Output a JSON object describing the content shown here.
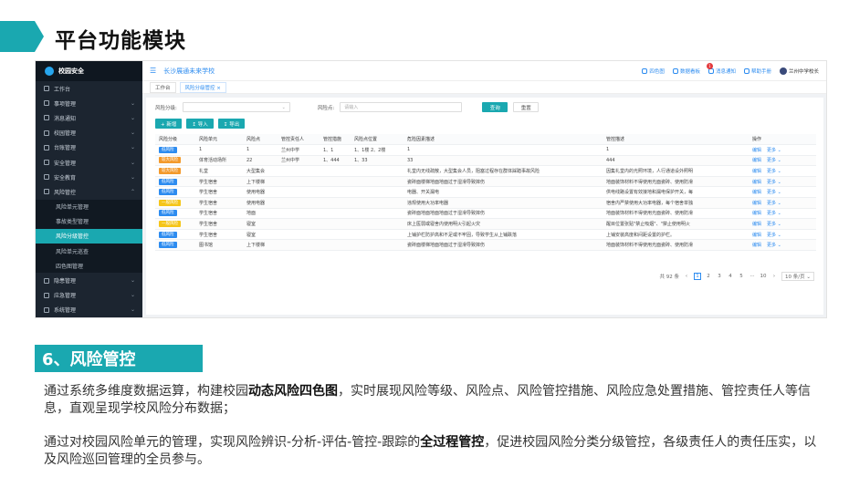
{
  "slide": {
    "title": "平台功能模块",
    "section_title": "6、风险管控",
    "para1": {
      "a": "通过系统多维度数据运算，构建校园",
      "b": "动态风险四色图",
      "c": "，实时展现风险等级、风险点、风险管控措施、风险应急处置措施、管控责任人等信息，直观呈现学校风险分布数据；"
    },
    "para2": {
      "a": "通过对校园风险单元的管理，实现风险辨识-分析-评估-管控-跟踪的",
      "b": "全过程管控",
      "c": "，促进校园风险分类分级管控，各级责任人的责任压实，以及风险巡回管理的全员参与。"
    }
  },
  "app": {
    "logo": "校园安全",
    "school": "长沙展通未来学校",
    "tools": {
      "t1": "四色图",
      "t2": "数据看板",
      "t3": "消息通知",
      "t3_badge": "1",
      "t4": "帮助手册",
      "user": "兰州中学校长"
    },
    "menu": [
      {
        "label": "工作台",
        "chev": ""
      },
      {
        "label": "事项管理",
        "chev": "⌄"
      },
      {
        "label": "消息通知",
        "chev": "⌄"
      },
      {
        "label": "校园管理",
        "chev": "⌄"
      },
      {
        "label": "台账管理",
        "chev": "⌄"
      },
      {
        "label": "安全管理",
        "chev": "⌄"
      },
      {
        "label": "安全教育",
        "chev": "⌄"
      },
      {
        "label": "风险管控",
        "chev": "⌃"
      }
    ],
    "submenu": [
      "风险单元管理",
      "事故类型管理",
      "风险分级管控",
      "风险单元巡查",
      "四色图管理"
    ],
    "menu_after": [
      {
        "label": "隐患管理",
        "chev": "⌄"
      },
      {
        "label": "应急管理",
        "chev": "⌄"
      },
      {
        "label": "系统管理",
        "chev": "⌄"
      }
    ],
    "tabs": [
      "工作台",
      "风险分级管控 ×"
    ],
    "filter": {
      "level_label": "风险分级:",
      "point_label": "风险点:",
      "point_placeholder": "请输入",
      "search": "查询",
      "reset": "重置"
    },
    "actions": {
      "add": "+ 新增",
      "import": "↥ 导入",
      "export": "↧ 导出"
    },
    "columns": [
      "风险分级",
      "风险单元",
      "风险点",
      "管控责任人",
      "管控措施",
      "风险点位置",
      "危险因素描述",
      "",
      "管控描述",
      "",
      "操作"
    ],
    "rows": [
      {
        "lvl": "低风险",
        "c": "#2d8cf0",
        "unit": "1",
        "point": "1",
        "resp": "兰州中学",
        "m": "1、1",
        "pos": "1、1楼 2、2楼",
        "risk": "1",
        "ctrl": "1",
        "edit": "编辑",
        "more": "更多 ⌄"
      },
      {
        "lvl": "较大风险",
        "c": "#f39a2c",
        "unit": "体育活动场所",
        "point": "22",
        "resp": "兰州中学",
        "m": "1、444",
        "pos": "1、33",
        "risk": "33",
        "ctrl": "444",
        "edit": "编辑",
        "more": "更多 ⌄"
      },
      {
        "lvl": "较大风险",
        "c": "#f39a2c",
        "unit": "礼堂",
        "point": "大型集会",
        "resp": "",
        "m": "",
        "pos": "",
        "risk": "礼堂内无线疏散，大型集会人员，阻塞过程存在群体踩踏事故风险",
        "ctrl": "因集礼堂内的光照环境，人行通道设外照明",
        "edit": "编辑",
        "more": "更多 ⌄"
      },
      {
        "lvl": "低风险",
        "c": "#2d8cf0",
        "unit": "学生宿舍",
        "point": "上下楼梯",
        "resp": "",
        "m": "",
        "pos": "",
        "risk": "瓷砖面楼梯地面地面过于湿滑导致摔伤",
        "ctrl": "地面装饰材料不得使用光面瓷砖、使用防滑",
        "edit": "编辑",
        "more": "更多 ⌄"
      },
      {
        "lvl": "低风险",
        "c": "#2d8cf0",
        "unit": "学生宿舍",
        "point": "使用电器",
        "resp": "",
        "m": "",
        "pos": "",
        "risk": "电器、开关漏电",
        "ctrl": "供电线路设置有效接地和漏电保护开关，每",
        "edit": "编辑",
        "more": "更多 ⌄"
      },
      {
        "lvl": "一般风险",
        "c": "#f5c518",
        "unit": "学生宿舍",
        "point": "使用电器",
        "resp": "",
        "m": "",
        "pos": "",
        "risk": "违规使用大功率电器",
        "ctrl": "宿舍内严禁使用大功率电器，每个宿舍单独",
        "edit": "编辑",
        "more": "更多 ⌄"
      },
      {
        "lvl": "低风险",
        "c": "#2d8cf0",
        "unit": "学生宿舍",
        "point": "地面",
        "resp": "",
        "m": "",
        "pos": "",
        "risk": "瓷砖面地面地面地面过于湿滑导致摔伤",
        "ctrl": "地面装饰材料不得使用光面瓷砖、使用防滑",
        "edit": "编辑",
        "more": "更多 ⌄"
      },
      {
        "lvl": "一般风险",
        "c": "#f5c518",
        "unit": "学生宿舍",
        "point": "寝室",
        "resp": "",
        "m": "",
        "pos": "",
        "risk": "床上医弱或寝舍内使用明火引起火灾",
        "ctrl": "醒目位置张贴\"禁止吸烟\"、\"禁止使用明火",
        "edit": "编辑",
        "more": "更多 ⌄"
      },
      {
        "lvl": "低风险",
        "c": "#2d8cf0",
        "unit": "学生宿舍",
        "point": "寝室",
        "resp": "",
        "m": "",
        "pos": "",
        "risk": "上铺护栏防护高和不足或不牢固，导致学生从上铺跌落",
        "ctrl": "上铺安装高度和间距设置的护栏。",
        "edit": "编辑",
        "more": "更多 ⌄"
      },
      {
        "lvl": "低风险",
        "c": "#2d8cf0",
        "unit": "图书馆",
        "point": "上下楼梯",
        "resp": "",
        "m": "",
        "pos": "",
        "risk": "瓷砖面楼梯地面地面过于湿滑导致摔伤",
        "ctrl": "地面装饰材料不得使用光面瓷砖、使用防滑",
        "edit": "编辑",
        "more": "更多 ⌄"
      }
    ],
    "pager": {
      "total": "共 92 条",
      "prev": "‹",
      "p1": "1",
      "p2": "2",
      "p3": "3",
      "p4": "4",
      "p5": "5",
      "dots": "···",
      "last": "10",
      "next": "›",
      "size": "10 条/页 ⌄"
    }
  }
}
